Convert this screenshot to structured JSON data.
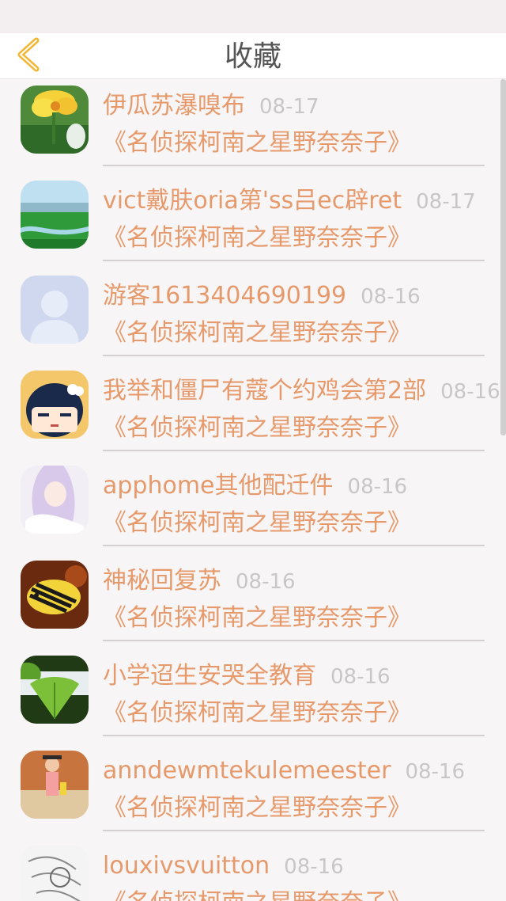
{
  "header": {
    "title": "收藏",
    "back_icon": "chevron-left-icon",
    "accent": "#f2b632"
  },
  "colors": {
    "name": "#e69a6c",
    "date": "#c7c7c7",
    "background": "#f8f5f6"
  },
  "favorites": [
    {
      "name": "伊瓜苏瀑嗅布",
      "date": "08-17",
      "work": "《名侦探柯南之星野奈奈子》",
      "avatar": "yellow-flower-avatar"
    },
    {
      "name": "vict戴肤oria第'ss吕ec辟ret",
      "date": "08-17",
      "work": "《名侦探柯南之星野奈奈子》",
      "avatar": "landscape-avatar"
    },
    {
      "name": "游客1613404690199",
      "date": "08-16",
      "work": "《名侦探柯南之星野奈奈子》",
      "avatar": "default-user-avatar"
    },
    {
      "name": "我举和僵尸有蔻个约鸡会第2部",
      "date": "08-16",
      "work": "《名侦探柯南之星野奈奈子》",
      "avatar": "cartoon-girl-avatar"
    },
    {
      "name": "apphome其他配迁件",
      "date": "08-16",
      "work": "《名侦探柯南之星野奈奈子》",
      "avatar": "anime-girl-avatar"
    },
    {
      "name": "神秘回复苏",
      "date": "08-16",
      "work": "《名侦探柯南之星野奈奈子》",
      "avatar": "fish-avatar"
    },
    {
      "name": "小学迢生安哭全教育",
      "date": "08-16",
      "work": "《名侦探柯南之星野奈奈子》",
      "avatar": "ginkgo-avatar"
    },
    {
      "name": "anndewmtekulemeester",
      "date": "08-16",
      "work": "《名侦探柯南之星野奈奈子》",
      "avatar": "photo-girl-avatar"
    },
    {
      "name": "louxivsvuitton",
      "date": "08-16",
      "work": "《名侦探柯南之星野奈奈子》",
      "avatar": "sketch-avatar"
    }
  ]
}
